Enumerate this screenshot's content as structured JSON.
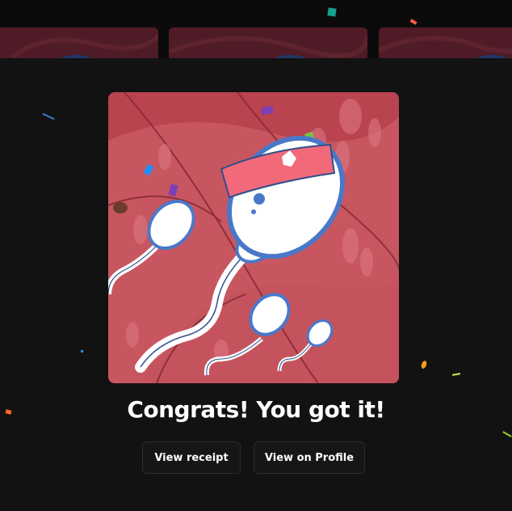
{
  "modal": {
    "headline": "Congrats! You got it!"
  },
  "actions": {
    "view_receipt": "View receipt",
    "view_on_profile": "View on Profile"
  },
  "colors": {
    "background": "#121212",
    "button_background": "#161616",
    "button_border": "#2c2c2c",
    "art_background": "#c0525a",
    "headband": "#f26a7a"
  },
  "artwork": {
    "subject": "sperm-characters-illustration"
  }
}
